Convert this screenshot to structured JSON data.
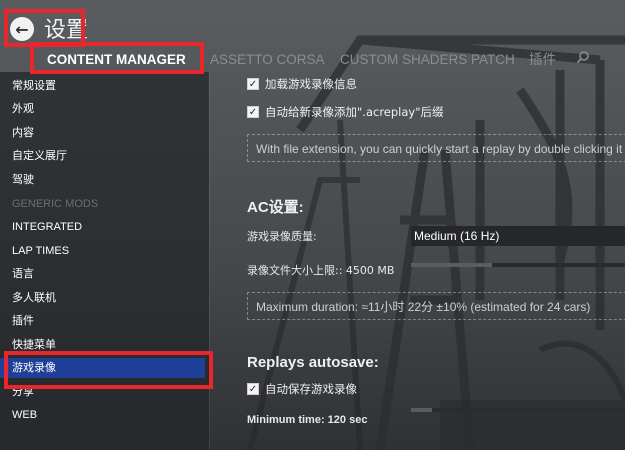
{
  "header": {
    "title": "设置",
    "tabs": [
      "CONTENT MANAGER",
      "ASSETTO CORSA",
      "CUSTOM SHADERS PATCH",
      "插件"
    ]
  },
  "sidebar": {
    "items": [
      {
        "label": "常规设置"
      },
      {
        "label": "外观"
      },
      {
        "label": "内容"
      },
      {
        "label": "自定义展厅"
      },
      {
        "label": "驾驶"
      },
      {
        "label": "GENERIC MODS"
      },
      {
        "label": "INTEGRATED"
      },
      {
        "label": "LAP TIMES"
      },
      {
        "label": "语言"
      },
      {
        "label": "多人联机"
      },
      {
        "label": "插件"
      },
      {
        "label": "快捷菜单"
      },
      {
        "label": "游戏录像"
      },
      {
        "label": "分享"
      },
      {
        "label": "WEB"
      }
    ],
    "selected": "游戏录像"
  },
  "main": {
    "checkboxes": [
      {
        "label": "加载游戏录像信息",
        "checked": true
      },
      {
        "label": "自动给新录像添加\".acreplay\"后缀",
        "checked": true
      }
    ],
    "info_ext": "With file extension, you can quickly start a replay by double clicking it in Explorer.",
    "ac_section": "AC设置:",
    "quality_label": "游戏录像质量:",
    "quality_value": "Medium (16 Hz)",
    "maxsize_label": "录像文件大小上限:: 4500 MB",
    "maxsize_fraction": 0.38,
    "duration_info": "Maximum duration: ≈11小时 22分 ±10% (estimated for 24 cars)",
    "autosave_section": "Replays autosave:",
    "autosave_checkbox": {
      "label": "自动保存游戏录像",
      "checked": true
    },
    "min_time_label": "Minimum time: 120 sec",
    "min_time_fraction": 0.1
  },
  "colors": {
    "selected": "#1f3f99",
    "highlight": "#e8262c"
  }
}
